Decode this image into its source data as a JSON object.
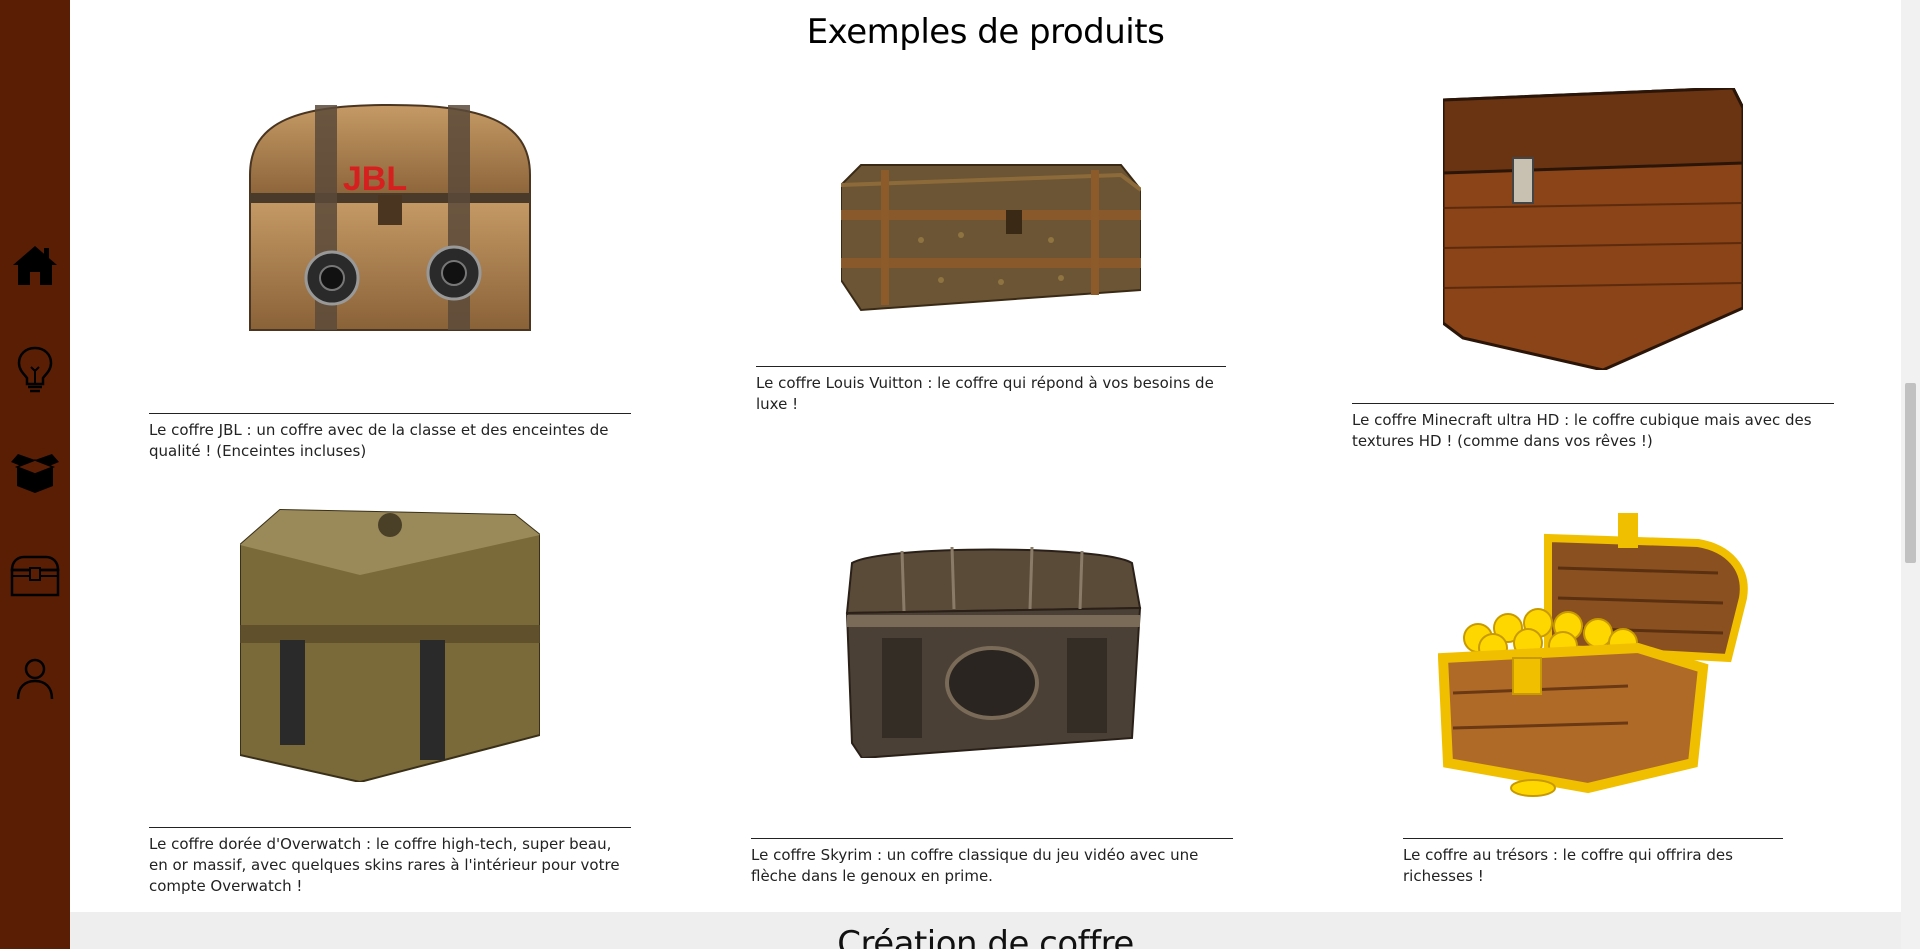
{
  "sidebar": {
    "items": [
      {
        "name": "home",
        "icon": "home-icon"
      },
      {
        "name": "ideas",
        "icon": "lightbulb-icon"
      },
      {
        "name": "products",
        "icon": "open-box-icon"
      },
      {
        "name": "chests",
        "icon": "chest-icon"
      },
      {
        "name": "account",
        "icon": "user-icon"
      }
    ],
    "background": "#5a1e04"
  },
  "products_section": {
    "title": "Exemples de produits",
    "items": [
      {
        "name": "jbl",
        "caption": "Le coffre JBL : un coffre avec de la classe et des enceintes de qualité ! (Enceintes incluses)"
      },
      {
        "name": "louis-vuitton",
        "caption": "Le coffre Louis Vuitton : le coffre qui répond à vos besoins de luxe !"
      },
      {
        "name": "minecraft",
        "caption": "Le coffre Minecraft ultra HD : le coffre cubique mais avec des textures HD ! (comme dans vos rêves !)"
      },
      {
        "name": "overwatch",
        "caption": "Le coffre dorée d'Overwatch : le coffre high-tech, super beau, en or massif, avec quelques skins rares à l'intérieur pour votre compte Overwatch !"
      },
      {
        "name": "skyrim",
        "caption": "Le coffre Skyrim : un coffre classique du jeu vidéo avec une flèche dans le genoux en prime."
      },
      {
        "name": "treasure",
        "caption": "Le coffre au trésors : le coffre qui offrira des richesses !"
      }
    ]
  },
  "creation_section": {
    "title": "Création de coffre"
  },
  "colors": {
    "sidebar": "#5a1e04",
    "lower_band": "#eeeeee"
  }
}
